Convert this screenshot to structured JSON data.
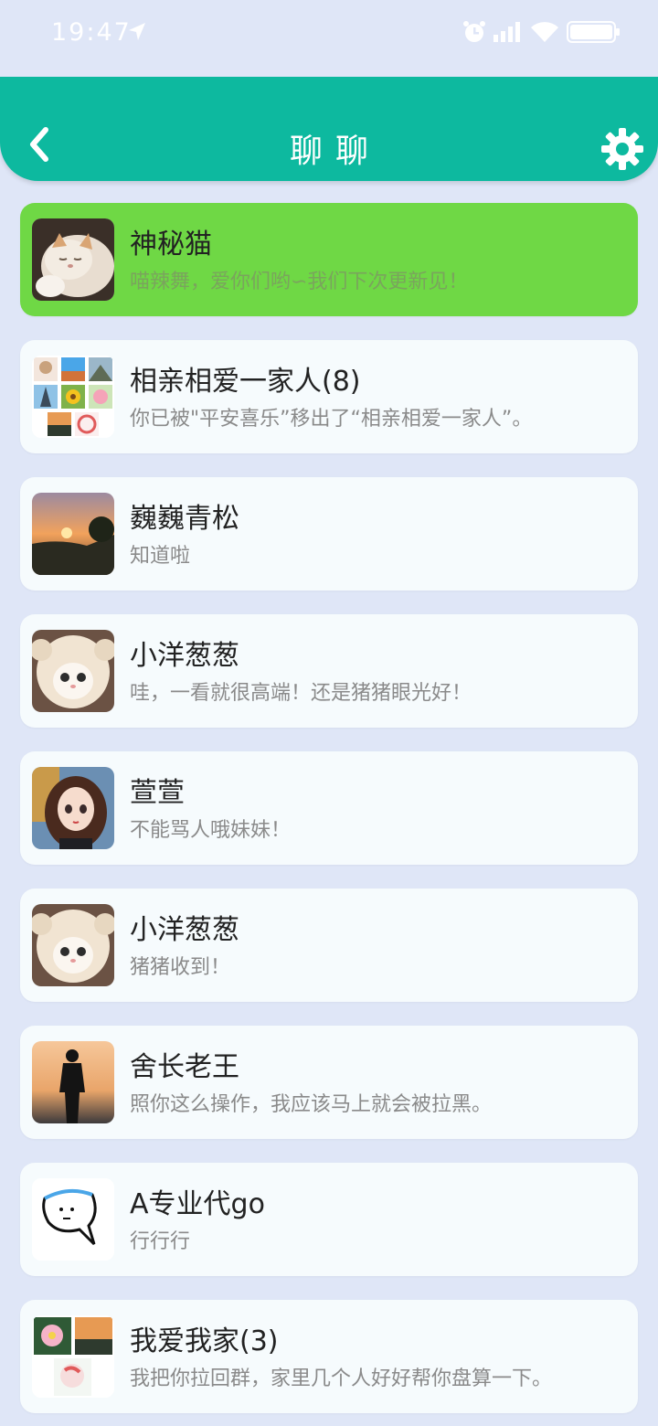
{
  "status_bar": {
    "time": "19:47"
  },
  "header": {
    "title": "聊聊"
  },
  "chats": [
    {
      "name": "神秘猫",
      "preview": "喵辣舞，爱你们哟∽我们下次更新见！",
      "avatar": "cat-photo"
    },
    {
      "name": "相亲相爱一家人(8)",
      "preview": "你已被\"平安喜乐”移出了“相亲相爱一家人”。",
      "avatar": "group-collage"
    },
    {
      "name": "巍巍青松",
      "preview": "知道啦",
      "avatar": "sunset-photo"
    },
    {
      "name": "小洋葱葱",
      "preview": "哇，一看就很高端！还是猪猪眼光好！",
      "avatar": "kitten-hat-photo"
    },
    {
      "name": "萱萱",
      "preview": "不能骂人哦妹妹！",
      "avatar": "cartoon-girl"
    },
    {
      "name": "小洋葱葱",
      "preview": "猪猪收到！",
      "avatar": "kitten-hat-photo"
    },
    {
      "name": "舍长老王",
      "preview": "照你这么操作，我应该马上就会被拉黑。",
      "avatar": "silhouette-photo"
    },
    {
      "name": "A专业代go",
      "preview": "行行行",
      "avatar": "speech-bubble-drawing"
    },
    {
      "name": "我爱我家(3)",
      "preview": "我把你拉回群，家里几个人好好帮你盘算一下。",
      "avatar": "group-collage-small"
    }
  ],
  "colors": {
    "accent": "#0db99f",
    "active": "#6fd845",
    "background": "#dfe6f7"
  }
}
